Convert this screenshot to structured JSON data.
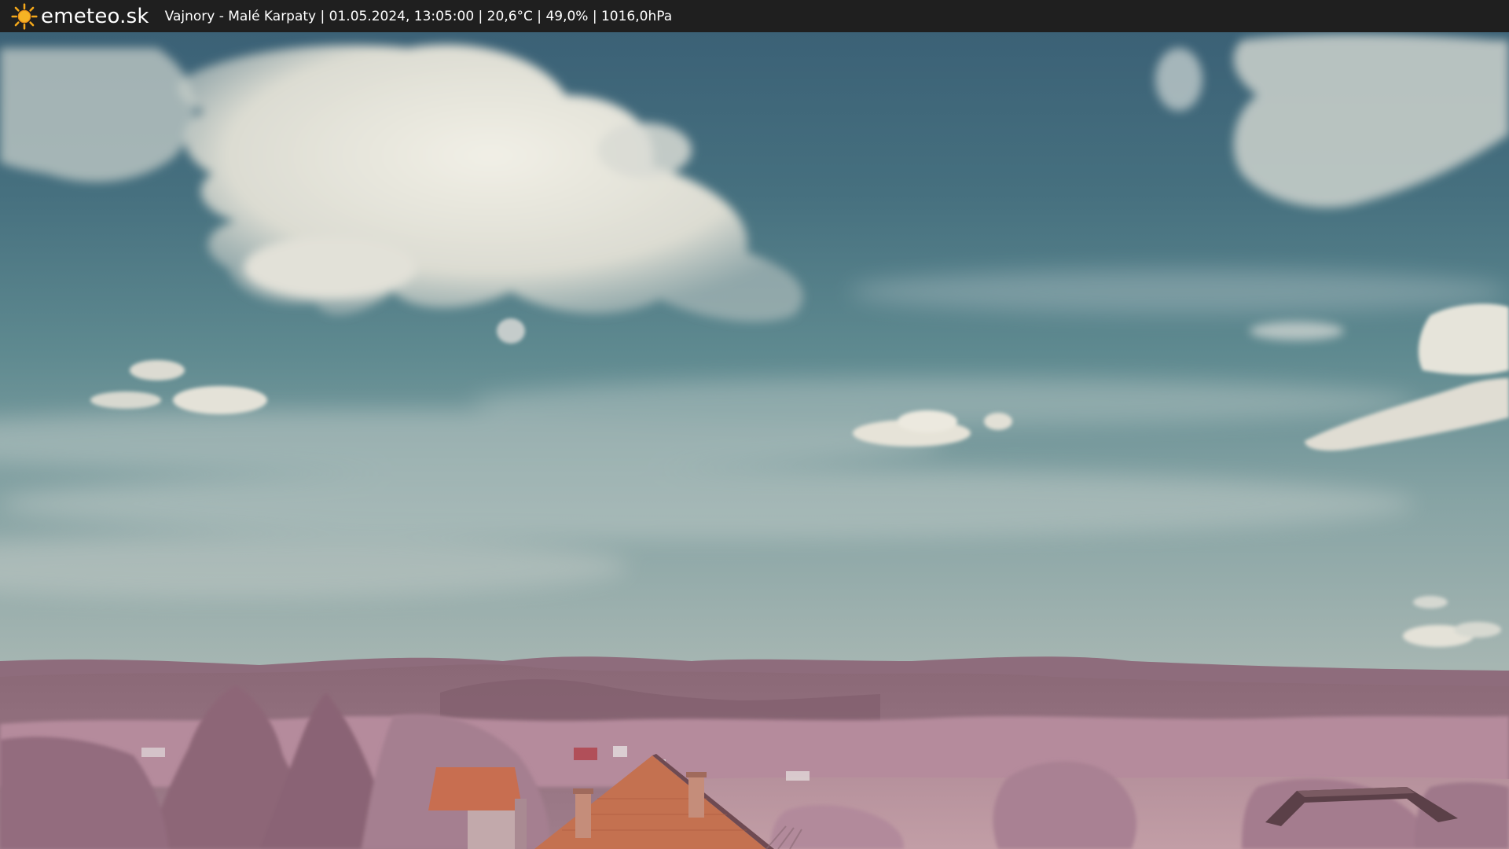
{
  "header": {
    "logo_text": "emeteo.sk",
    "logo_icon": "sun-icon",
    "caption": "Vajnory - Malé Karpaty | 01.05.2024, 13:05:00 | 20,6°C | 49,0% | 1016,0hPa"
  },
  "colors": {
    "bar": "#1f1f1f",
    "sun": "#f4a81a",
    "sky_top": "#3e6a80",
    "sky_horizon": "#9aaeae",
    "foliage": "#b0809a",
    "roof": "#c9704f"
  }
}
